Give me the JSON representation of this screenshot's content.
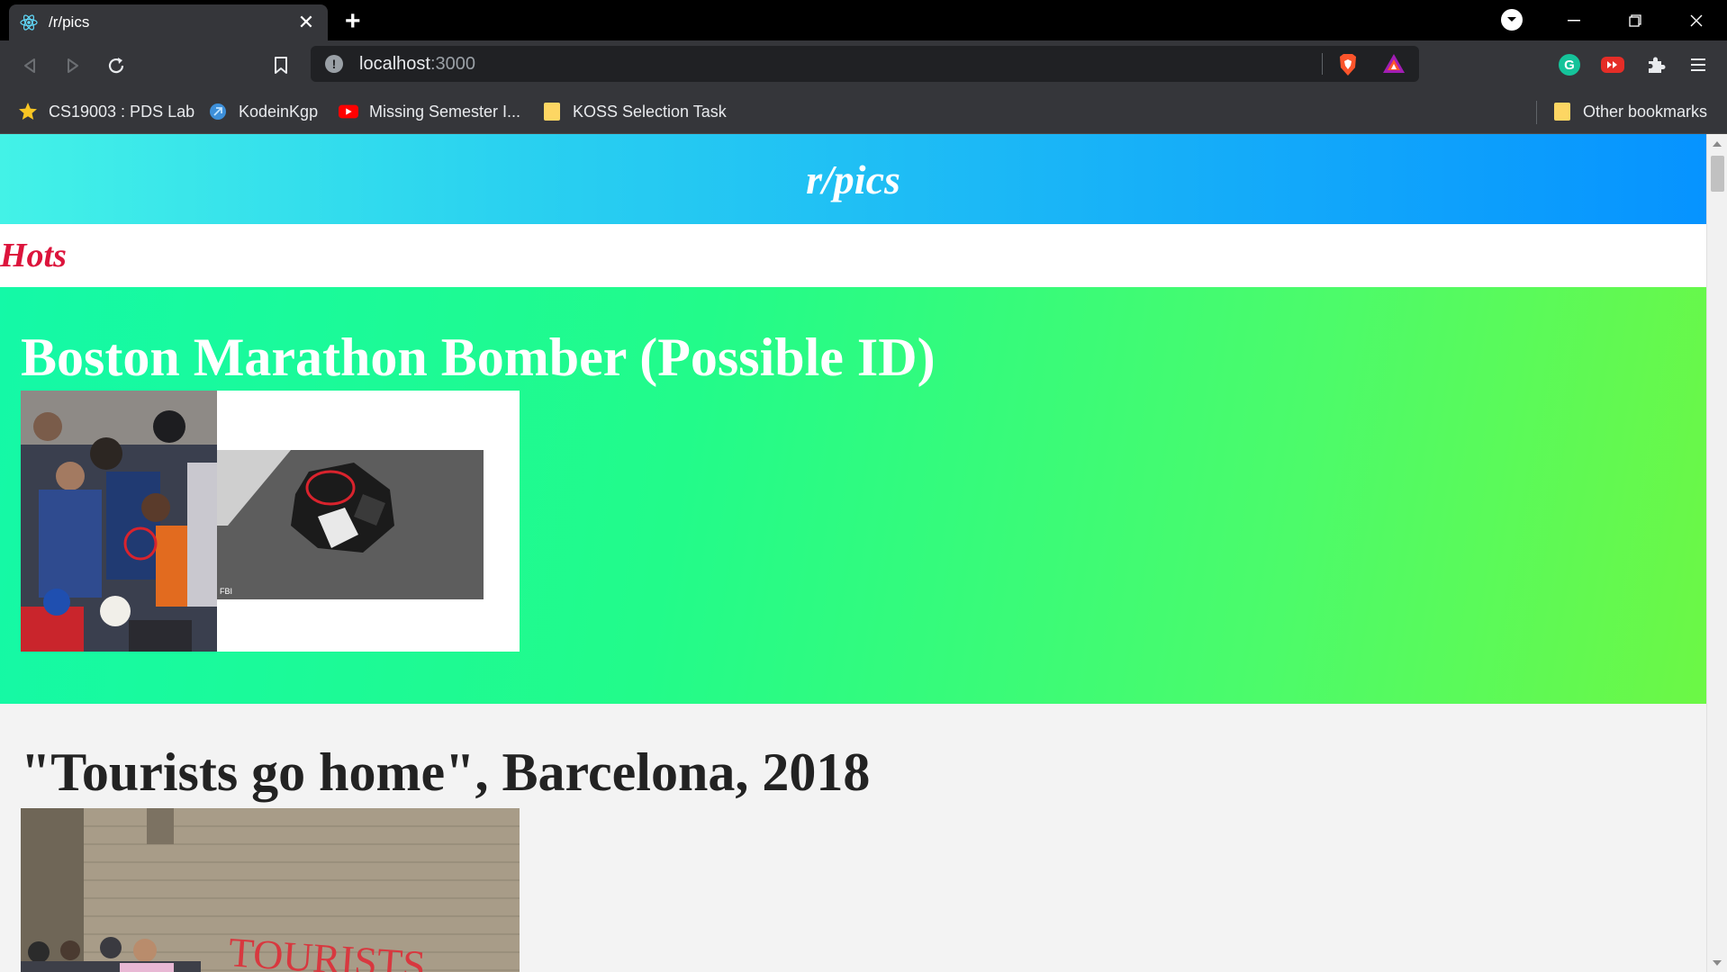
{
  "browser": {
    "tab_title": "/r/pics",
    "url_host": "localhost",
    "url_port": ":3000",
    "bookmarks": [
      {
        "label": "CS19003 : PDS Lab",
        "icon": "star-icon"
      },
      {
        "label": "KodeinKgp",
        "icon": "kodeinkgp-icon"
      },
      {
        "label": "Missing Semester I...",
        "icon": "youtube-icon"
      },
      {
        "label": "KOSS Selection Task",
        "icon": "folder-icon"
      }
    ],
    "other_bookmarks": "Other bookmarks"
  },
  "page": {
    "site_title": "r/pics",
    "section_title": "Hots",
    "posts": [
      {
        "title": "Boston Marathon Bomber (Possible ID)",
        "image_caption": "FBI"
      },
      {
        "title": "\"Tourists go home\", Barcelona, 2018",
        "image_caption": "TOURISTS"
      }
    ]
  },
  "colors": {
    "header_gradient_start": "#43f2e7",
    "header_gradient_end": "#0693ff",
    "section_title": "#dc143c",
    "hot_post_gradient_start": "#14f9a7",
    "hot_post_gradient_end": "#6cf845"
  }
}
